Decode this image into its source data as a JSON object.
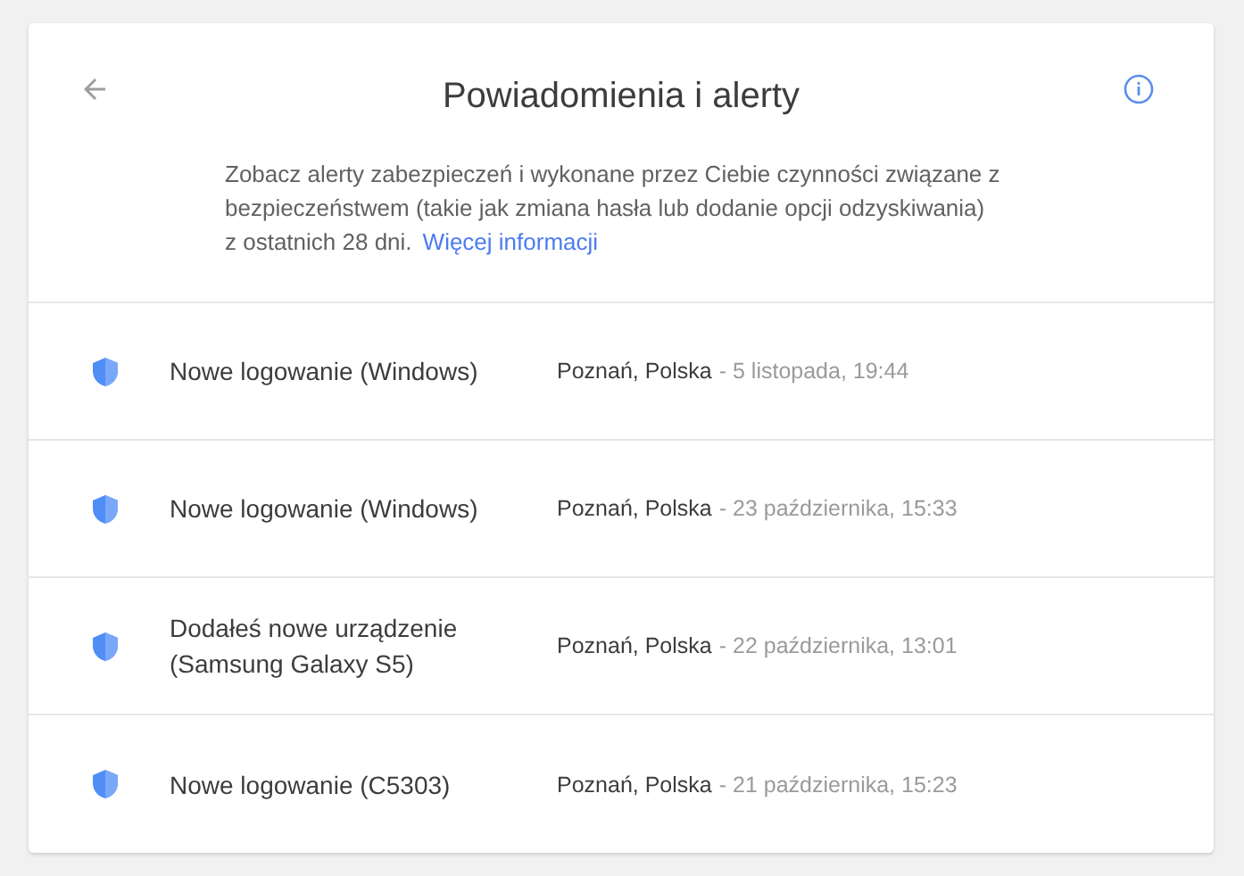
{
  "header": {
    "title": "Powiadomienia i alerty",
    "description": "Zobacz alerty zabezpieczeń i wykonane przez Ciebie czynności związane z bezpieczeństwem (takie jak zmiana hasła lub dodanie opcji odzyskiwania) z ostatnich 28 dni.",
    "link": "Więcej informacji"
  },
  "events": [
    {
      "title": "Nowe logowanie (Windows)",
      "location": "Poznań, Polska",
      "time": "- 5 listopada, 19:44"
    },
    {
      "title": "Nowe logowanie (Windows)",
      "location": "Poznań, Polska",
      "time": "- 23 października, 15:33"
    },
    {
      "title": "Dodałeś nowe urządzenie (Samsung Galaxy S5)",
      "location": "Poznań, Polska",
      "time": "- 22 października, 13:01"
    },
    {
      "title": "Nowe logowanie (C5303)",
      "location": "Poznań, Polska",
      "time": "- 21 października, 15:23"
    }
  ]
}
